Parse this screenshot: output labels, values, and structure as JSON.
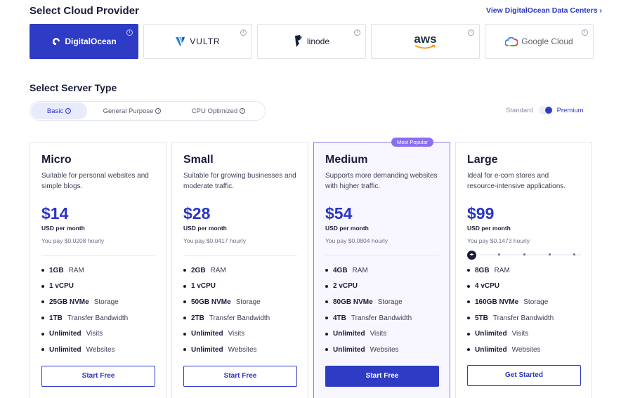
{
  "provider_section": {
    "title": "Select Cloud Provider",
    "link": "View DigitalOcean Data Centers ›",
    "providers": [
      {
        "name": "DigitalOcean",
        "active": true
      },
      {
        "name": "VULTR",
        "active": false
      },
      {
        "name": "linode",
        "active": false
      },
      {
        "name": "aws",
        "active": false
      },
      {
        "name": "Google Cloud",
        "active": false
      }
    ],
    "info_glyph": "i"
  },
  "server_section": {
    "title": "Select Server Type",
    "tabs": [
      {
        "label": "Basic",
        "active": true
      },
      {
        "label": "General Purpose",
        "active": false
      },
      {
        "label": "CPU Optimized",
        "active": false
      }
    ],
    "toggle": {
      "left_label": "Standard",
      "right_label": "Premium",
      "value": "Premium"
    }
  },
  "plans": [
    {
      "name": "Micro",
      "description": "Suitable for personal websites and simple blogs.",
      "price": "$14",
      "period": "USD per month",
      "hourly": "You pay $0.0208 hourly",
      "features": [
        {
          "strong": "1GB",
          "rest": "RAM"
        },
        {
          "strong": "1 vCPU",
          "rest": ""
        },
        {
          "strong": "25GB NVMe",
          "rest": "Storage"
        },
        {
          "strong": "1TB",
          "rest": "Transfer Bandwidth"
        },
        {
          "strong": "Unlimited",
          "rest": "Visits"
        },
        {
          "strong": "Unlimited",
          "rest": "Websites"
        }
      ],
      "cta": "Start Free"
    },
    {
      "name": "Small",
      "description": "Suitable for growing businesses and moderate traffic.",
      "price": "$28",
      "period": "USD per month",
      "hourly": "You pay $0.0417 hourly",
      "features": [
        {
          "strong": "2GB",
          "rest": "RAM"
        },
        {
          "strong": "1 vCPU",
          "rest": ""
        },
        {
          "strong": "50GB NVMe",
          "rest": "Storage"
        },
        {
          "strong": "2TB",
          "rest": "Transfer Bandwidth"
        },
        {
          "strong": "Unlimited",
          "rest": "Visits"
        },
        {
          "strong": "Unlimited",
          "rest": "Websites"
        }
      ],
      "cta": "Start Free"
    },
    {
      "name": "Medium",
      "badge": "Most Popular",
      "description": "Supports more demanding websites with higher traffic.",
      "price": "$54",
      "period": "USD per month",
      "hourly": "You pay $0.0804 hourly",
      "features": [
        {
          "strong": "4GB",
          "rest": "RAM"
        },
        {
          "strong": "2 vCPU",
          "rest": ""
        },
        {
          "strong": "80GB NVMe",
          "rest": "Storage"
        },
        {
          "strong": "4TB",
          "rest": "Transfer Bandwidth"
        },
        {
          "strong": "Unlimited",
          "rest": "Visits"
        },
        {
          "strong": "Unlimited",
          "rest": "Websites"
        }
      ],
      "cta": "Start Free"
    },
    {
      "name": "Large",
      "description": "Ideal for e-com stores and resource-intensive applications.",
      "price": "$99",
      "period": "USD per month",
      "hourly": "You pay $0.1473 hourly",
      "slider": {
        "value": 0,
        "steps": 5
      },
      "features": [
        {
          "strong": "8GB",
          "rest": "RAM"
        },
        {
          "strong": "4 vCPU",
          "rest": ""
        },
        {
          "strong": "160GB NVMe",
          "rest": "Storage"
        },
        {
          "strong": "5TB",
          "rest": "Transfer Bandwidth"
        },
        {
          "strong": "Unlimited",
          "rest": "Visits"
        },
        {
          "strong": "Unlimited",
          "rest": "Websites"
        }
      ],
      "cta": "Get Started"
    }
  ],
  "colors": {
    "accent": "#2e3bc4",
    "badge": "#8a6ff0",
    "text": "#1a1d3a"
  }
}
